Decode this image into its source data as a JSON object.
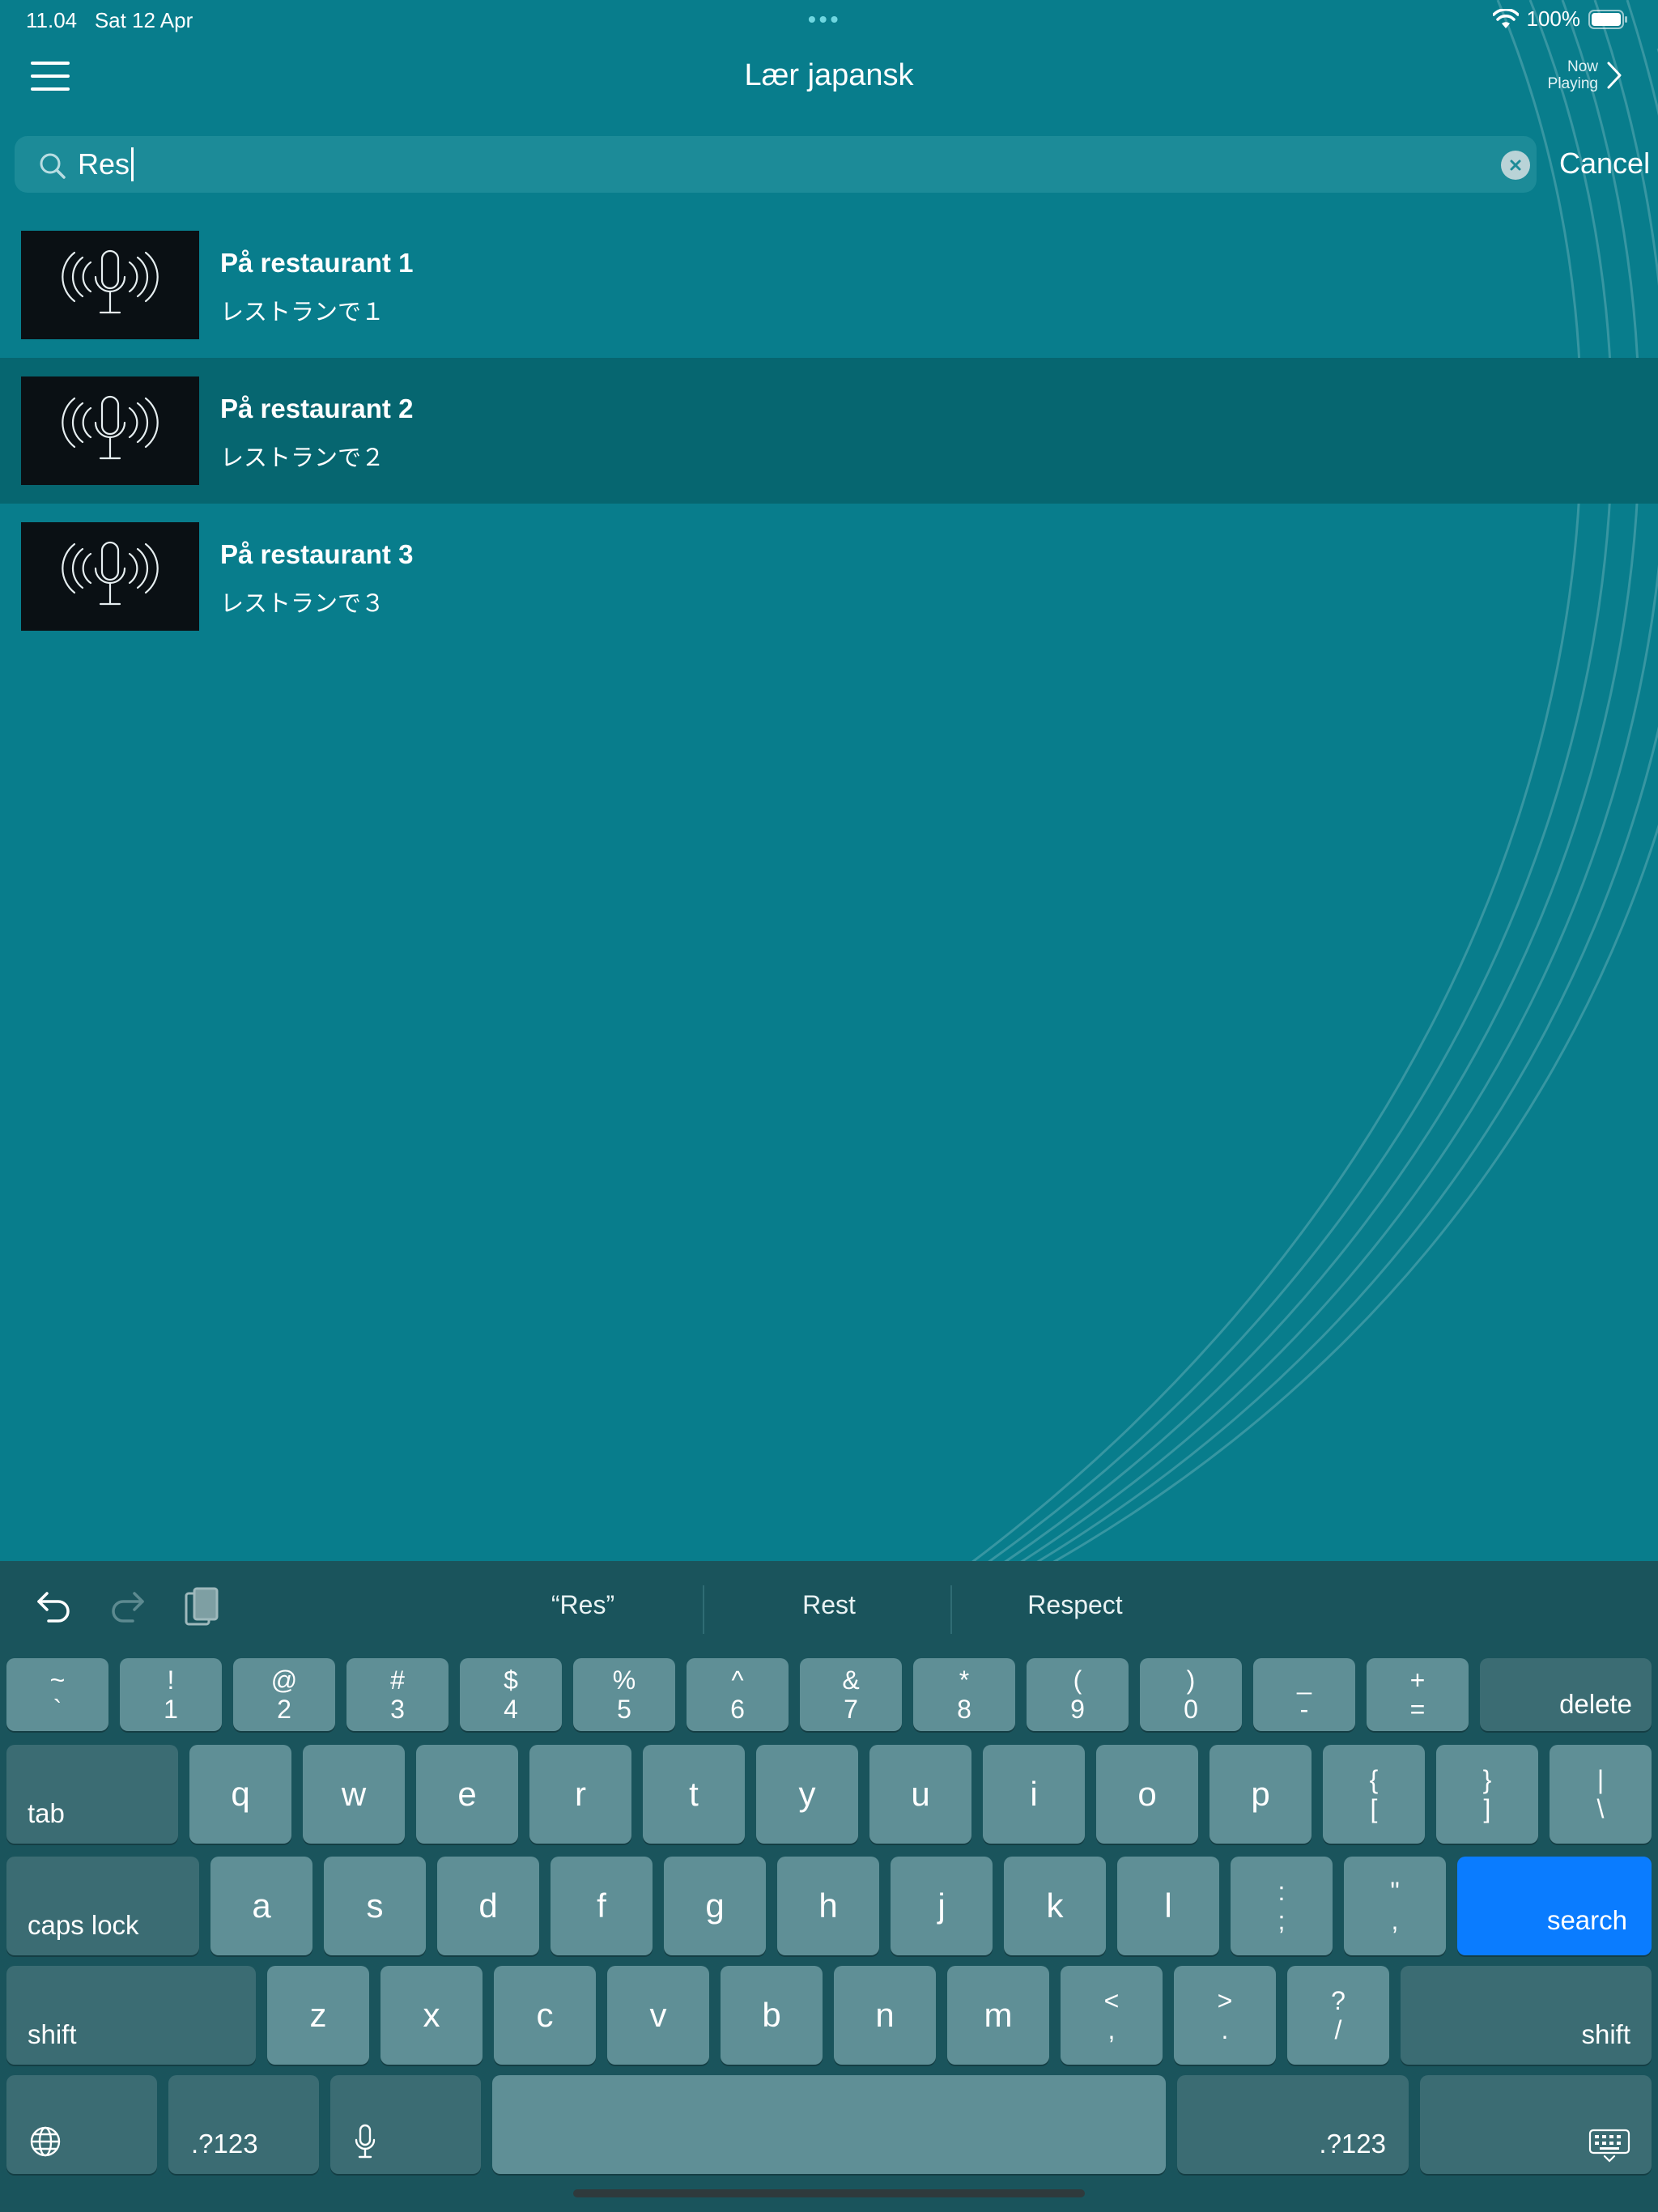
{
  "status_bar": {
    "time": "11.04",
    "date": "Sat 12 Apr",
    "battery": "100%"
  },
  "nav": {
    "title": "Lær japansk",
    "now_playing": [
      "Now",
      "Playing"
    ]
  },
  "search": {
    "query": "Res",
    "cancel_label": "Cancel"
  },
  "results": [
    {
      "title": "På restaurant 1",
      "subtitle": "レストランで１",
      "selected": false
    },
    {
      "title": "På restaurant 2",
      "subtitle": "レストランで２",
      "selected": true
    },
    {
      "title": "På restaurant 3",
      "subtitle": "レストランで３",
      "selected": false
    }
  ],
  "keyboard": {
    "suggestions": [
      "“Res”",
      "Rest",
      "Respect"
    ],
    "number_row": [
      {
        "top": "~",
        "bottom": "`"
      },
      {
        "top": "!",
        "bottom": "1"
      },
      {
        "top": "@",
        "bottom": "2"
      },
      {
        "top": "#",
        "bottom": "3"
      },
      {
        "top": "$",
        "bottom": "4"
      },
      {
        "top": "%",
        "bottom": "5"
      },
      {
        "top": "^",
        "bottom": "6"
      },
      {
        "top": "&",
        "bottom": "7"
      },
      {
        "top": "*",
        "bottom": "8"
      },
      {
        "top": "(",
        "bottom": "9"
      },
      {
        "top": ")",
        "bottom": "0"
      },
      {
        "top": "_",
        "bottom": "-"
      },
      {
        "top": "+",
        "bottom": "="
      }
    ],
    "row_q": [
      "q",
      "w",
      "e",
      "r",
      "t",
      "y",
      "u",
      "i",
      "o",
      "p"
    ],
    "row_q_symbols": [
      {
        "top": "{",
        "bottom": "["
      },
      {
        "top": "}",
        "bottom": "]"
      },
      {
        "top": "|",
        "bottom": "\\"
      }
    ],
    "row_a": [
      "a",
      "s",
      "d",
      "f",
      "g",
      "h",
      "j",
      "k",
      "l"
    ],
    "row_a_symbols": [
      {
        "top": ":",
        "bottom": ";"
      },
      {
        "top": "\"",
        "bottom": ","
      }
    ],
    "row_z": [
      "z",
      "x",
      "c",
      "v",
      "b",
      "n",
      "m"
    ],
    "row_z_symbols": [
      {
        "top": "<",
        "bottom": ","
      },
      {
        "top": ">",
        "bottom": "."
      },
      {
        "top": "?",
        "bottom": "/"
      }
    ],
    "labels": {
      "delete": "delete",
      "tab": "tab",
      "caps_lock": "caps lock",
      "search": "search",
      "shift": "shift",
      "numbers": ".?123"
    }
  },
  "colors": {
    "background": "#087d8c",
    "selected_row": "#066670",
    "keyboard_bg": "#1a545c",
    "key": "#5f8f96",
    "key_dark": "#3b6c73",
    "search_key": "#0a7cff"
  }
}
